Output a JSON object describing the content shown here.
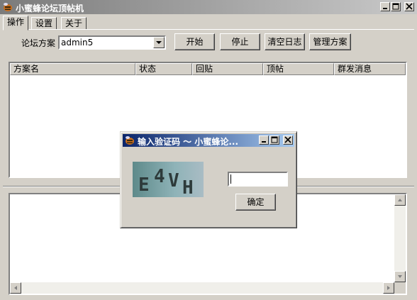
{
  "window": {
    "title": "小蜜蜂论坛顶帖机",
    "icon": "bee-app-icon",
    "controls": [
      "minimize",
      "maximize",
      "close"
    ]
  },
  "tabs": [
    {
      "label": "操作",
      "active": true
    },
    {
      "label": "设置",
      "active": false
    },
    {
      "label": "关于",
      "active": false
    }
  ],
  "toolbar": {
    "scheme_label": "论坛方案",
    "scheme_value": "admin5",
    "start_label": "开始",
    "stop_label": "停止",
    "clear_log_label": "清空日志",
    "manage_label": "管理方案"
  },
  "list": {
    "columns": [
      "方案名",
      "状态",
      "回贴",
      "顶帖",
      "群发消息"
    ],
    "rows": []
  },
  "log": {
    "content": ""
  },
  "dialog": {
    "title": "输入验证码 ～ 小蜜蜂论...",
    "captcha_text": "E4VH",
    "input_value": "",
    "ok_label": "确定"
  },
  "colors": {
    "face": "#d4d0c8",
    "main_titlebar": "#7b7b7b",
    "dialog_titlebar": "#0a246a"
  }
}
